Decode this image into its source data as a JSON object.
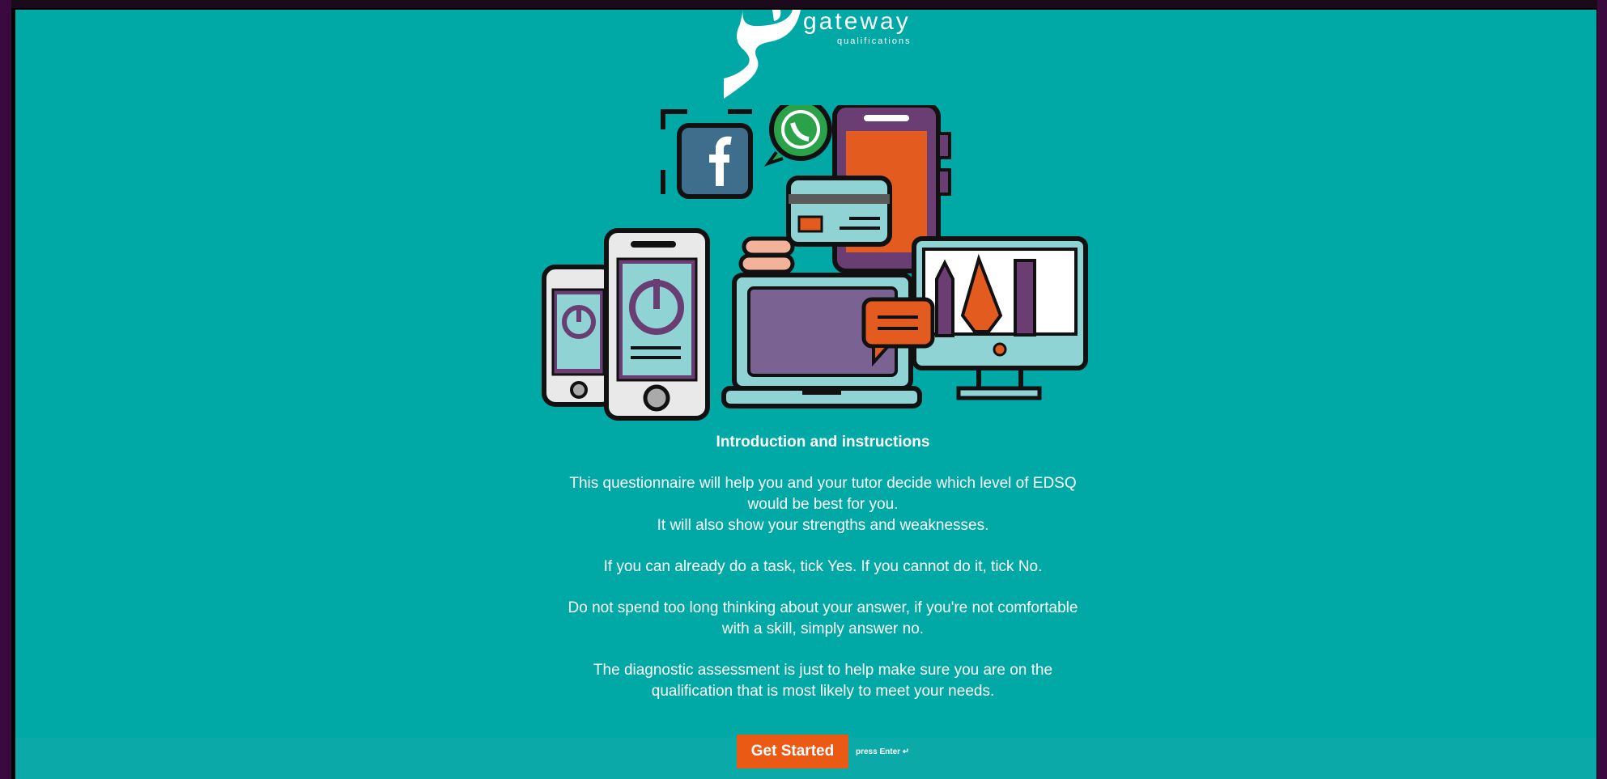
{
  "brand": {
    "name": "gateway",
    "tagline": "qualifications"
  },
  "intro": {
    "heading": "Introduction and instructions",
    "paragraph1_line1": "This questionnaire will help you and your tutor decide which level of EDSQ",
    "paragraph1_line2": "would be best for you.",
    "paragraph1_line3": "It will also show your strengths and weaknesses.",
    "paragraph2": "If you can already do a task, tick Yes. If you cannot do it, tick No.",
    "paragraph3_line1": "Do not spend too long thinking about your answer, if you're not comfortable",
    "paragraph3_line2": "with a skill, simply answer no.",
    "paragraph4_line1": "The diagnostic assessment is just to help make sure you are on the",
    "paragraph4_line2": "qualification that is most likely to meet your needs."
  },
  "footer": {
    "start_label": "Get Started",
    "enter_hint": "press Enter ↵"
  },
  "colors": {
    "background": "#00a8a6",
    "accent": "#ea5a15",
    "frame": "#3a0a3f"
  }
}
